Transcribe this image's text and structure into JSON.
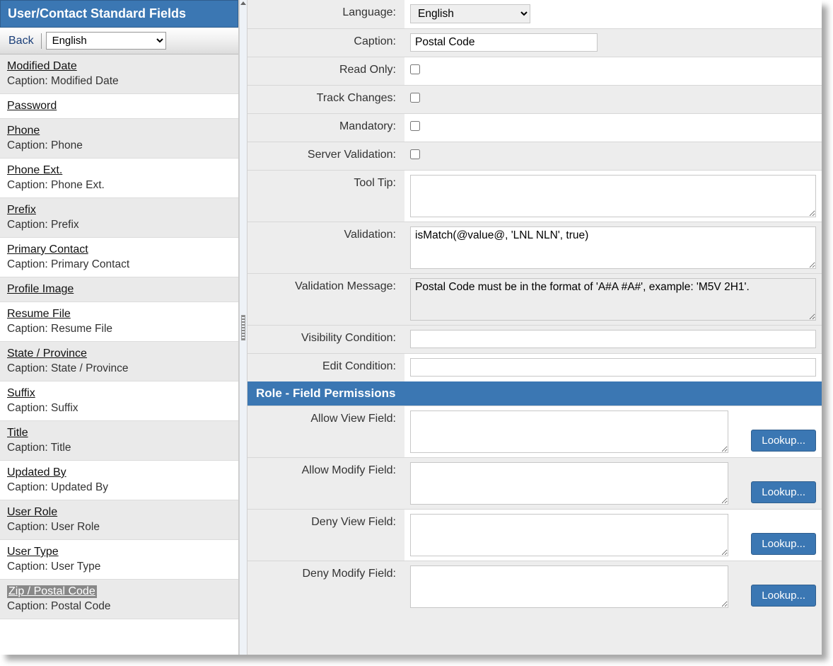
{
  "sidebar": {
    "title": "User/Contact Standard Fields",
    "back_label": "Back",
    "language": "English",
    "items": [
      {
        "name": "Modified Date",
        "caption": "Caption: Modified Date"
      },
      {
        "name": "Password",
        "caption": ""
      },
      {
        "name": "Phone",
        "caption": "Caption: Phone"
      },
      {
        "name": "Phone Ext.",
        "caption": "Caption: Phone Ext."
      },
      {
        "name": "Prefix",
        "caption": "Caption: Prefix"
      },
      {
        "name": "Primary Contact",
        "caption": "Caption: Primary Contact"
      },
      {
        "name": "Profile Image",
        "caption": ""
      },
      {
        "name": "Resume File",
        "caption": "Caption: Resume File"
      },
      {
        "name": "State / Province",
        "caption": "Caption: State / Province"
      },
      {
        "name": "Suffix",
        "caption": "Caption: Suffix"
      },
      {
        "name": "Title",
        "caption": "Caption: Title"
      },
      {
        "name": "Updated By",
        "caption": "Caption: Updated By"
      },
      {
        "name": "User Role",
        "caption": "Caption: User Role"
      },
      {
        "name": "User Type",
        "caption": "Caption: User Type"
      },
      {
        "name": "Zip / Postal Code",
        "caption": "Caption: Postal Code"
      }
    ],
    "selected_index": 14
  },
  "form": {
    "labels": {
      "language": "Language:",
      "caption": "Caption:",
      "read_only": "Read Only:",
      "track_changes": "Track Changes:",
      "mandatory": "Mandatory:",
      "server_validation": "Server Validation:",
      "tool_tip": "Tool Tip:",
      "validation": "Validation:",
      "validation_message": "Validation Message:",
      "visibility_condition": "Visibility Condition:",
      "edit_condition": "Edit Condition:"
    },
    "values": {
      "language": "English",
      "caption": "Postal Code",
      "read_only": false,
      "track_changes": false,
      "mandatory": false,
      "server_validation": false,
      "tool_tip": "",
      "validation": "isMatch(@value@, 'LNL NLN', true)",
      "validation_message": "Postal Code must be in the format of 'A#A #A#', example: 'M5V 2H1'.",
      "visibility_condition": "",
      "edit_condition": ""
    }
  },
  "permissions": {
    "header": "Role - Field Permissions",
    "labels": {
      "allow_view": "Allow View Field:",
      "allow_modify": "Allow Modify Field:",
      "deny_view": "Deny View Field:",
      "deny_modify": "Deny Modify Field:"
    },
    "lookup_label": "Lookup...",
    "values": {
      "allow_view": "",
      "allow_modify": "",
      "deny_view": "",
      "deny_modify": ""
    }
  }
}
